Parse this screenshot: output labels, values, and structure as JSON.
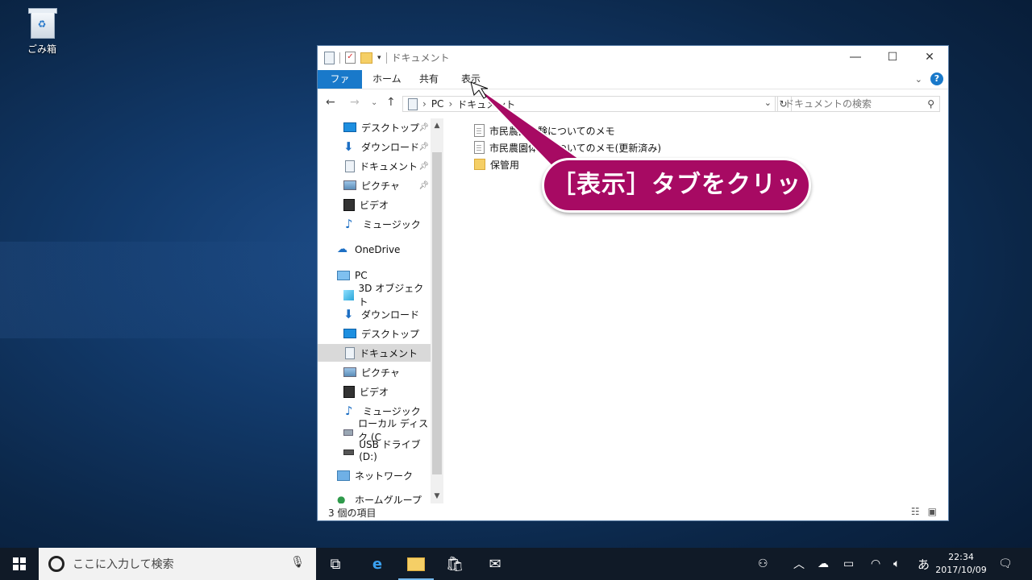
{
  "desktop": {
    "recycle_bin_label": "ごみ箱"
  },
  "window": {
    "title": "ドキュメント",
    "ribbon_tabs": [
      "ファイル",
      "ホーム",
      "共有",
      "表示"
    ],
    "address": {
      "root": "PC",
      "current": "ドキュメント"
    },
    "search_placeholder": "ドキュメントの検索",
    "nav": {
      "quick_access": [
        {
          "label": "デスクトップ",
          "icon": "desktop-icon",
          "pinned": true
        },
        {
          "label": "ダウンロード",
          "icon": "download-icon",
          "pinned": true
        },
        {
          "label": "ドキュメント",
          "icon": "document-icon",
          "pinned": true
        },
        {
          "label": "ピクチャ",
          "icon": "picture-icon",
          "pinned": true
        },
        {
          "label": "ビデオ",
          "icon": "video-icon",
          "pinned": false
        },
        {
          "label": "ミュージック",
          "icon": "music-icon",
          "pinned": false
        }
      ],
      "onedrive": "OneDrive",
      "pc": "PC",
      "pc_items": [
        {
          "label": "3D オブジェクト",
          "icon": "cube-icon"
        },
        {
          "label": "ダウンロード",
          "icon": "download-icon"
        },
        {
          "label": "デスクトップ",
          "icon": "desktop-icon"
        },
        {
          "label": "ドキュメント",
          "icon": "document-icon",
          "selected": true
        },
        {
          "label": "ピクチャ",
          "icon": "picture-icon"
        },
        {
          "label": "ビデオ",
          "icon": "video-icon"
        },
        {
          "label": "ミュージック",
          "icon": "music-icon"
        },
        {
          "label": "ローカル ディスク (C",
          "icon": "local-disk-icon"
        },
        {
          "label": "USB ドライブ (D:)",
          "icon": "usb-drive-icon"
        }
      ],
      "network": "ネットワーク",
      "homegroup": "ホームグループ"
    },
    "files": [
      {
        "name": "市民農園体験についてのメモ",
        "type": "document"
      },
      {
        "name": "市民農園体験についてのメモ(更新済み)",
        "type": "document"
      },
      {
        "name": "保管用",
        "type": "folder"
      }
    ],
    "status": "3 個の項目"
  },
  "callout": {
    "text": "［表示］タブをクリック"
  },
  "taskbar": {
    "search_placeholder": "ここに入力して検索",
    "ime": "あ",
    "time": "22:34",
    "date": "2017/10/09"
  },
  "colors": {
    "accent": "#1979ca",
    "callout": "#a70a63",
    "taskbar": "#101a27"
  }
}
